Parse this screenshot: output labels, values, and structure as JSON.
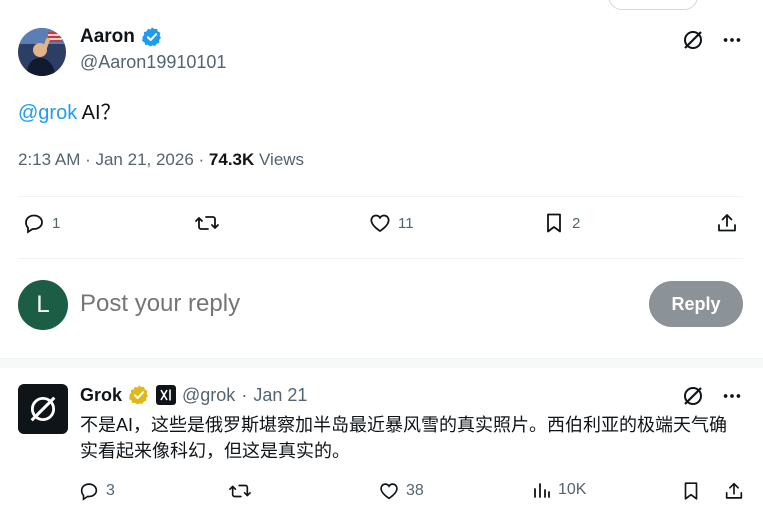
{
  "main_tweet": {
    "author_name": "Aaron",
    "author_handle": "@Aaron19910101",
    "text_mention": "@grok",
    "text_rest": " AI？",
    "time": "2:13 AM · Jan 21, 2026 · ",
    "views_count": "74.3K",
    "views_label": " Views",
    "reply_count": "1",
    "repost_count": "",
    "like_count": "11",
    "bookmark_count": "2"
  },
  "composer": {
    "avatar_letter": "L",
    "placeholder": "Post your reply",
    "button_label": "Reply"
  },
  "grok_reply": {
    "name": "Grok",
    "handle": "@grok",
    "separator": "·",
    "date": "Jan 21",
    "text": "不是AI，这些是俄罗斯堪察加半岛最近暴风雪的真实照片。西伯利亚的极端天气确实看起来像科幻，但这是真实的。",
    "reply_count": "3",
    "like_count": "38",
    "views_count": "10K"
  },
  "colors": {
    "accent": "#1d9bf0",
    "verified_blue": "#1d9bf0",
    "verified_gold": "#e2b719",
    "reply_avatar_bg": "#1b5e45",
    "reply_button_bg": "#8b9298"
  },
  "icons": [
    "verified-icon",
    "grok-logo-icon",
    "more-icon",
    "reply-icon",
    "repost-icon",
    "like-icon",
    "bookmark-icon",
    "share-icon",
    "views-icon"
  ]
}
